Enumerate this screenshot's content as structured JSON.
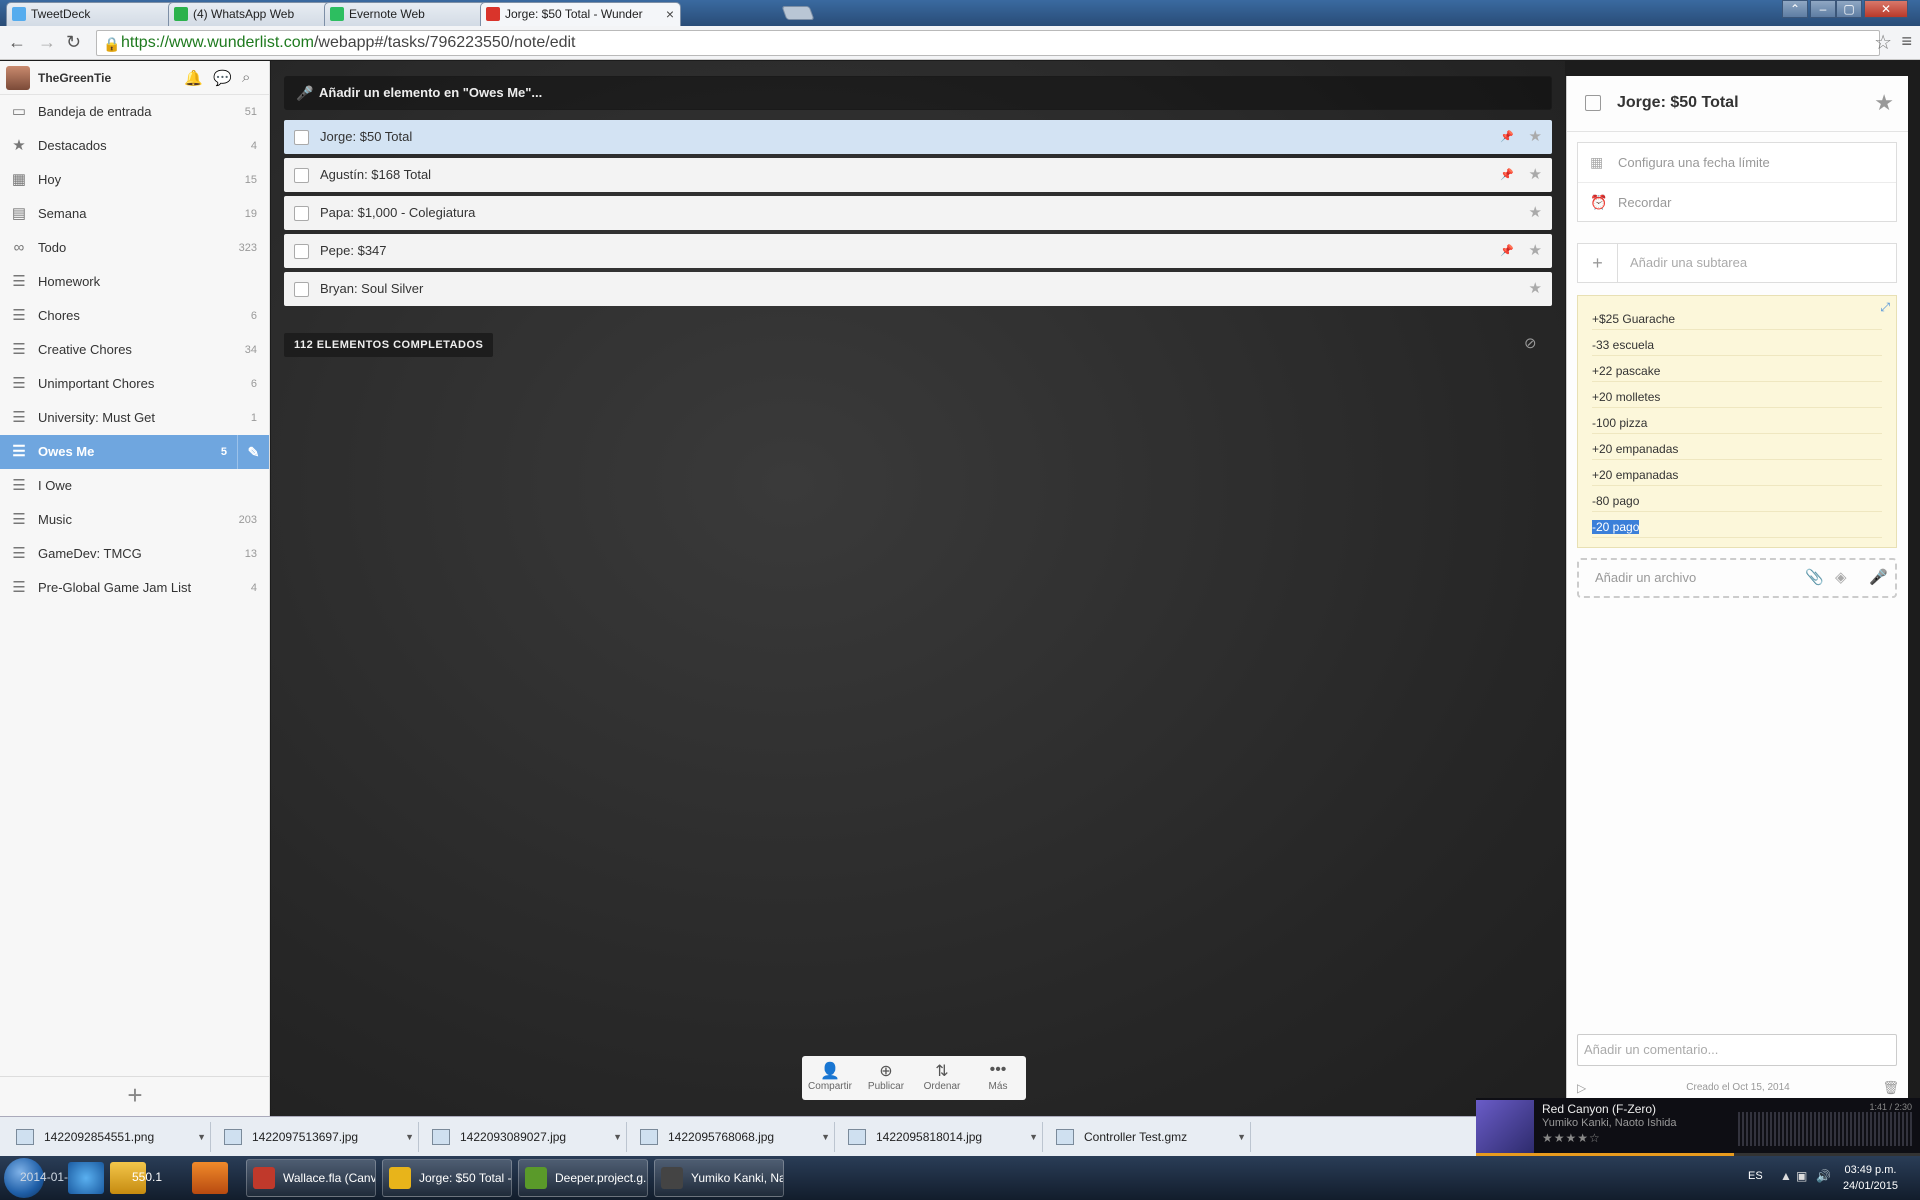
{
  "browser": {
    "tabs": [
      {
        "label": "TweetDeck",
        "color": "#55acee"
      },
      {
        "label": "(4) WhatsApp Web",
        "color": "#2bb24c"
      },
      {
        "label": "Evernote Web",
        "color": "#2dbe60"
      },
      {
        "label": "Jorge: $50 Total - Wunder",
        "color": "#d9342b"
      }
    ],
    "url_host": "https://www.wunderlist.com",
    "url_path": "/webapp#/tasks/796223550/note/edit"
  },
  "sidebar": {
    "username": "TheGreenTie",
    "items": [
      {
        "label": "Bandeja de entrada",
        "count": "51",
        "icon": "inbox-icon",
        "glyph": "▭"
      },
      {
        "label": "Destacados",
        "count": "4",
        "icon": "star-icon",
        "glyph": "★"
      },
      {
        "label": "Hoy",
        "count": "15",
        "icon": "calendar-today-icon",
        "glyph": "▦"
      },
      {
        "label": "Semana",
        "count": "19",
        "icon": "calendar-week-icon",
        "glyph": "▤"
      },
      {
        "label": "Todo",
        "count": "323",
        "icon": "infinity-icon",
        "glyph": "∞"
      },
      {
        "label": "Homework",
        "count": "",
        "icon": "list-icon",
        "glyph": "☰"
      },
      {
        "label": "Chores",
        "count": "6",
        "icon": "list-icon",
        "glyph": "☰"
      },
      {
        "label": "Creative Chores",
        "count": "34",
        "icon": "list-icon",
        "glyph": "☰"
      },
      {
        "label": "Unimportant Chores",
        "count": "6",
        "icon": "list-icon",
        "glyph": "☰"
      },
      {
        "label": "University: Must Get",
        "count": "1",
        "icon": "list-icon",
        "glyph": "☰"
      },
      {
        "label": "Owes Me",
        "count": "5",
        "icon": "list-icon",
        "glyph": "☰"
      },
      {
        "label": "I Owe",
        "count": "",
        "icon": "list-icon",
        "glyph": "☰"
      },
      {
        "label": "Music",
        "count": "203",
        "icon": "list-icon",
        "glyph": "☰"
      },
      {
        "label": "GameDev: TMCG",
        "count": "13",
        "icon": "list-icon",
        "glyph": "☰"
      },
      {
        "label": "Pre-Global Game Jam List",
        "count": "4",
        "icon": "list-icon",
        "glyph": "☰"
      }
    ],
    "active_index": 10
  },
  "main": {
    "add_placeholder": "Añadir un elemento en \"Owes Me\"...",
    "tasks": [
      {
        "label": "Jorge: $50 Total",
        "pinned": true
      },
      {
        "label": "Agustín: $168 Total",
        "pinned": true
      },
      {
        "label": "Papa: $1,000 - Colegiatura",
        "pinned": false
      },
      {
        "label": "Pepe: $347",
        "pinned": true
      },
      {
        "label": "Bryan: Soul Silver",
        "pinned": false
      }
    ],
    "completed_label": "112 ELEMENTOS COMPLETADOS",
    "toolbar": [
      {
        "label": "Compartir",
        "glyph": "👤",
        "icon": "share-icon"
      },
      {
        "label": "Publicar",
        "glyph": "⊕",
        "icon": "publish-icon"
      },
      {
        "label": "Ordenar",
        "glyph": "⇅",
        "icon": "sort-icon"
      },
      {
        "label": "Más",
        "glyph": "•••",
        "icon": "more-icon"
      }
    ]
  },
  "detail": {
    "title": "Jorge: $50 Total",
    "due_date": "Configura una fecha límite",
    "reminder": "Recordar",
    "subtask_placeholder": "Añadir una subtarea",
    "note_lines": [
      "+$25 Guarache",
      "-33 escuela",
      "+22 pascake",
      "+20 molletes",
      "-100 pizza",
      "+20 empanadas",
      "+20 empanadas",
      "-80 pago",
      "-20 pago"
    ],
    "attach_placeholder": "Añadir un archivo",
    "comment_placeholder": "Añadir un comentario...",
    "created": "Creado el Oct 15, 2014"
  },
  "downloads": [
    "1422092854551.png",
    "1422097513697.jpg",
    "1422093089027.jpg",
    "1422095768068.jpg",
    "1422095818014.jpg",
    "Controller Test.gmz"
  ],
  "player": {
    "track": "Red Canyon (F-Zero)",
    "artist": "Yumiko Kanki, Naoto Ishida",
    "rating": "★★★★☆",
    "time": "1:41 / 2:30",
    "progress": 0.58
  },
  "taskbar": {
    "apps": [
      {
        "label": "Wallace.fla (Canv...",
        "color": "#c0392b"
      },
      {
        "label": "Jorge: $50 Total - ...",
        "color": "#e8b41a"
      },
      {
        "label": "Deeper.project.g...",
        "color": "#5a9a2a"
      },
      {
        "label": "Yumiko Kanki, Na...",
        "color": "#444"
      }
    ],
    "overlay_left": "2014-01-26",
    "overlay_num": "550.1",
    "lang": "ES",
    "time": "03:49 p.m.",
    "date": "24/01/2015"
  }
}
